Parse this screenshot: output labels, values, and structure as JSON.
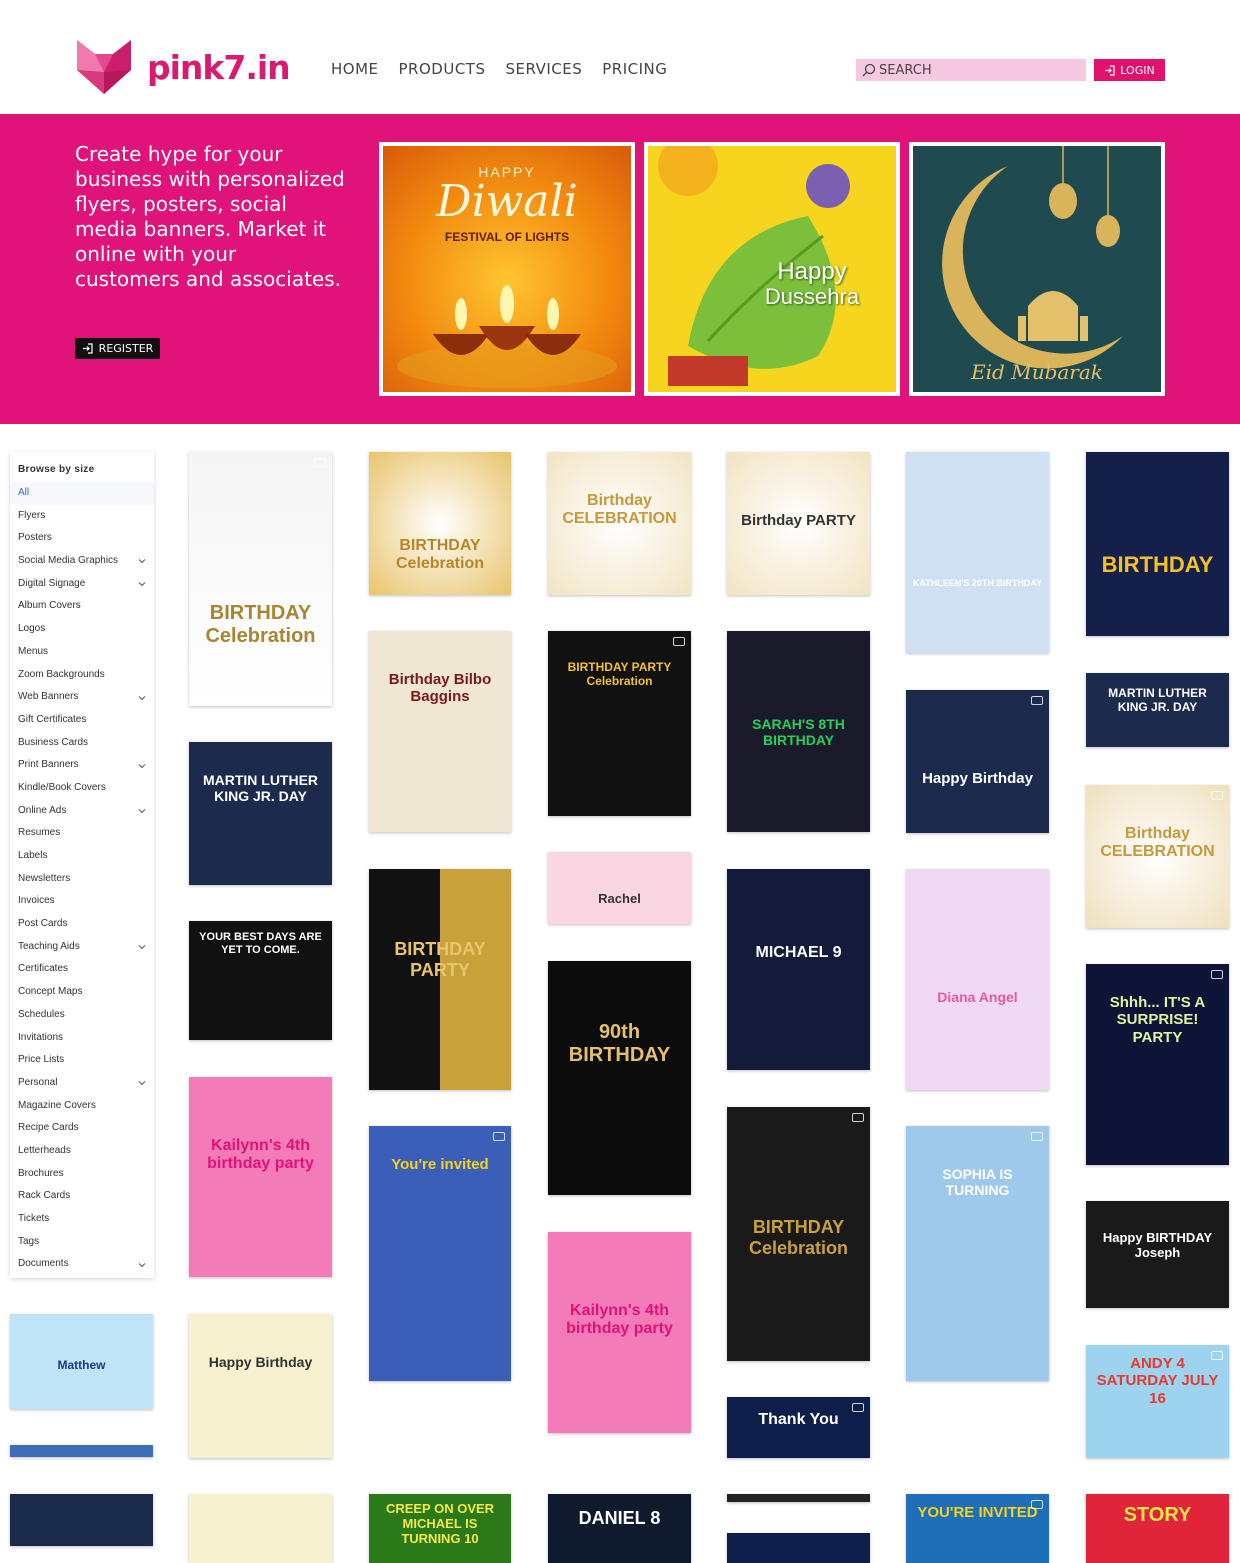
{
  "brand": {
    "name": "pink7.in",
    "color": "#d81b72"
  },
  "nav": {
    "items": [
      "HOME",
      "PRODUCTS",
      "SERVICES",
      "PRICING"
    ]
  },
  "search": {
    "placeholder": "SEARCH"
  },
  "login": {
    "label": "LOGIN"
  },
  "hero": {
    "text": "Create hype for your business with personalized flyers, posters, social media banners. Market it online with your customers and associates.",
    "register_label": "REGISTER",
    "banners": [
      {
        "line1": "HAPPY",
        "line2": "Diwali",
        "line3": "FESTIVAL OF LIGHTS"
      },
      {
        "line1": "Happy",
        "line2": "Dussehra"
      },
      {
        "line1": "Eid Mubarak"
      }
    ]
  },
  "sidebar": {
    "heading": "Browse by size",
    "items": [
      {
        "label": "All",
        "chevron": false,
        "active": true
      },
      {
        "label": "Flyers",
        "chevron": false
      },
      {
        "label": "Posters",
        "chevron": false
      },
      {
        "label": "Social Media Graphics",
        "chevron": true
      },
      {
        "label": "Digital Signage",
        "chevron": true
      },
      {
        "label": "Album Covers",
        "chevron": false
      },
      {
        "label": "Logos",
        "chevron": false
      },
      {
        "label": "Menus",
        "chevron": false
      },
      {
        "label": "Zoom Backgrounds",
        "chevron": false
      },
      {
        "label": "Web Banners",
        "chevron": true
      },
      {
        "label": "Gift Certificates",
        "chevron": false
      },
      {
        "label": "Business Cards",
        "chevron": false
      },
      {
        "label": "Print Banners",
        "chevron": true
      },
      {
        "label": "Kindle/Book Covers",
        "chevron": false
      },
      {
        "label": "Online Ads",
        "chevron": true
      },
      {
        "label": "Resumes",
        "chevron": false
      },
      {
        "label": "Labels",
        "chevron": false
      },
      {
        "label": "Newsletters",
        "chevron": false
      },
      {
        "label": "Invoices",
        "chevron": false
      },
      {
        "label": "Post Cards",
        "chevron": false
      },
      {
        "label": "Teaching Aids",
        "chevron": true
      },
      {
        "label": "Certificates",
        "chevron": false
      },
      {
        "label": "Concept Maps",
        "chevron": false
      },
      {
        "label": "Schedules",
        "chevron": false
      },
      {
        "label": "Invitations",
        "chevron": false
      },
      {
        "label": "Price Lists",
        "chevron": false
      },
      {
        "label": "Personal",
        "chevron": true
      },
      {
        "label": "Magazine Covers",
        "chevron": false
      },
      {
        "label": "Recipe Cards",
        "chevron": false
      },
      {
        "label": "Letterheads",
        "chevron": false
      },
      {
        "label": "Brochures",
        "chevron": false
      },
      {
        "label": "Rack Cards",
        "chevron": false
      },
      {
        "label": "Tickets",
        "chevron": false
      },
      {
        "label": "Tags",
        "chevron": false
      },
      {
        "label": "Documents",
        "chevron": true
      }
    ]
  },
  "cards": [
    {
      "text": "BIRTHDAY Celebration",
      "video": true
    },
    {
      "text": "MARTIN LUTHER KING JR. DAY"
    },
    {
      "text": "YOUR BEST DAYS ARE YET TO COME."
    },
    {
      "text": "Kailynn's 4th birthday party"
    },
    {
      "text": "Happy Birthday"
    },
    {
      "text": "BIRTHDAY Celebration"
    },
    {
      "text": "Birthday Bilbo Baggins"
    },
    {
      "text": "BIRTHDAY PARTY"
    },
    {
      "text": "You're invited",
      "video": true
    },
    {
      "text": "Birthday CELEBRATION"
    },
    {
      "text": "BIRTHDAY PARTY Celebration",
      "video": true
    },
    {
      "text": "Rachel"
    },
    {
      "text": "90th BIRTHDAY"
    },
    {
      "text": "Kailynn's 4th birthday party"
    },
    {
      "text": "DANIEL 8"
    },
    {
      "text": "Birthday PARTY"
    },
    {
      "text": "SARAH'S 8TH BIRTHDAY"
    },
    {
      "text": "MICHAEL 9"
    },
    {
      "text": "BIRTHDAY Celebration",
      "video": true
    },
    {
      "text": "Thank You",
      "video": true
    },
    {
      "text": "KATHLEEN'S 20TH BIRTHDAY"
    },
    {
      "text": "Happy Birthday",
      "video": true
    },
    {
      "text": "Diana Angel"
    },
    {
      "text": "SOPHIA IS TURNING",
      "video": true
    },
    {
      "text": "YOU'RE INVITED",
      "video": true
    },
    {
      "text": "BIRTHDAY"
    },
    {
      "text": "MARTIN LUTHER KING JR. DAY"
    },
    {
      "text": "Birthday CELEBRATION",
      "video": true
    },
    {
      "text": "Shhh... IT'S A SURPRISE! PARTY",
      "video": true
    },
    {
      "text": "Happy BIRTHDAY Joseph"
    },
    {
      "text": "ANDY 4 SATURDAY JULY 16",
      "video": true
    },
    {
      "text": "STORY"
    },
    {
      "text": "Matthew"
    },
    {
      "text": "CREEP ON OVER MICHAEL IS TURNING 10"
    }
  ]
}
